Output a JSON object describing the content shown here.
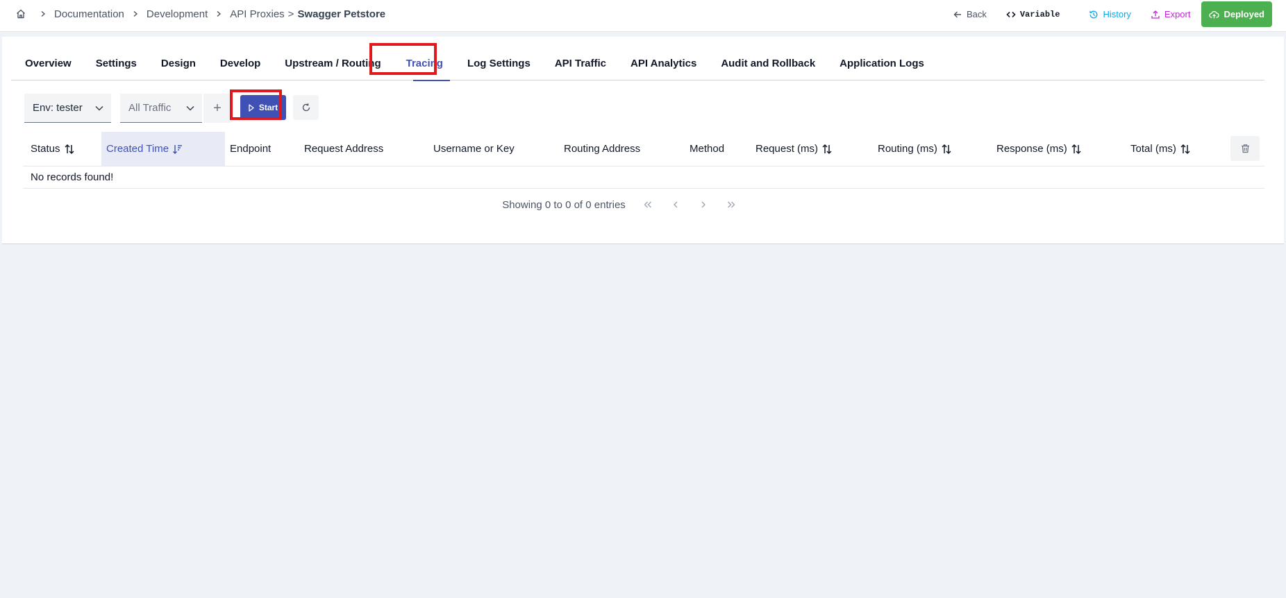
{
  "breadcrumb": {
    "items": [
      "Documentation",
      "Development",
      "API Proxies"
    ],
    "separator": ">",
    "current": "Swagger Petstore"
  },
  "actions": {
    "back": "Back",
    "variable": "Variable",
    "history": "History",
    "export": "Export",
    "deployed": "Deployed"
  },
  "tabs": [
    "Overview",
    "Settings",
    "Design",
    "Develop",
    "Upstream / Routing",
    "Tracing",
    "Log Settings",
    "API Traffic",
    "API Analytics",
    "Audit and Rollback",
    "Application Logs"
  ],
  "active_tab": "Tracing",
  "toolbar": {
    "env_select": "Env: tester",
    "traffic_select": "All Traffic",
    "add": "+",
    "start": "Start"
  },
  "table": {
    "columns": [
      "Status",
      "Created Time",
      "Endpoint",
      "Request Address",
      "Username or Key",
      "Routing Address",
      "Method",
      "Request (ms)",
      "Routing (ms)",
      "Response (ms)",
      "Total (ms)"
    ],
    "empty_message": "No records found!"
  },
  "pagination": {
    "info": "Showing 0 to 0 of 0 entries"
  },
  "colors": {
    "accent": "#3f51b5",
    "deployed": "#4caf50",
    "history": "#0ea5e9",
    "export": "#c026d3",
    "highlight_box": "#e0191e"
  }
}
